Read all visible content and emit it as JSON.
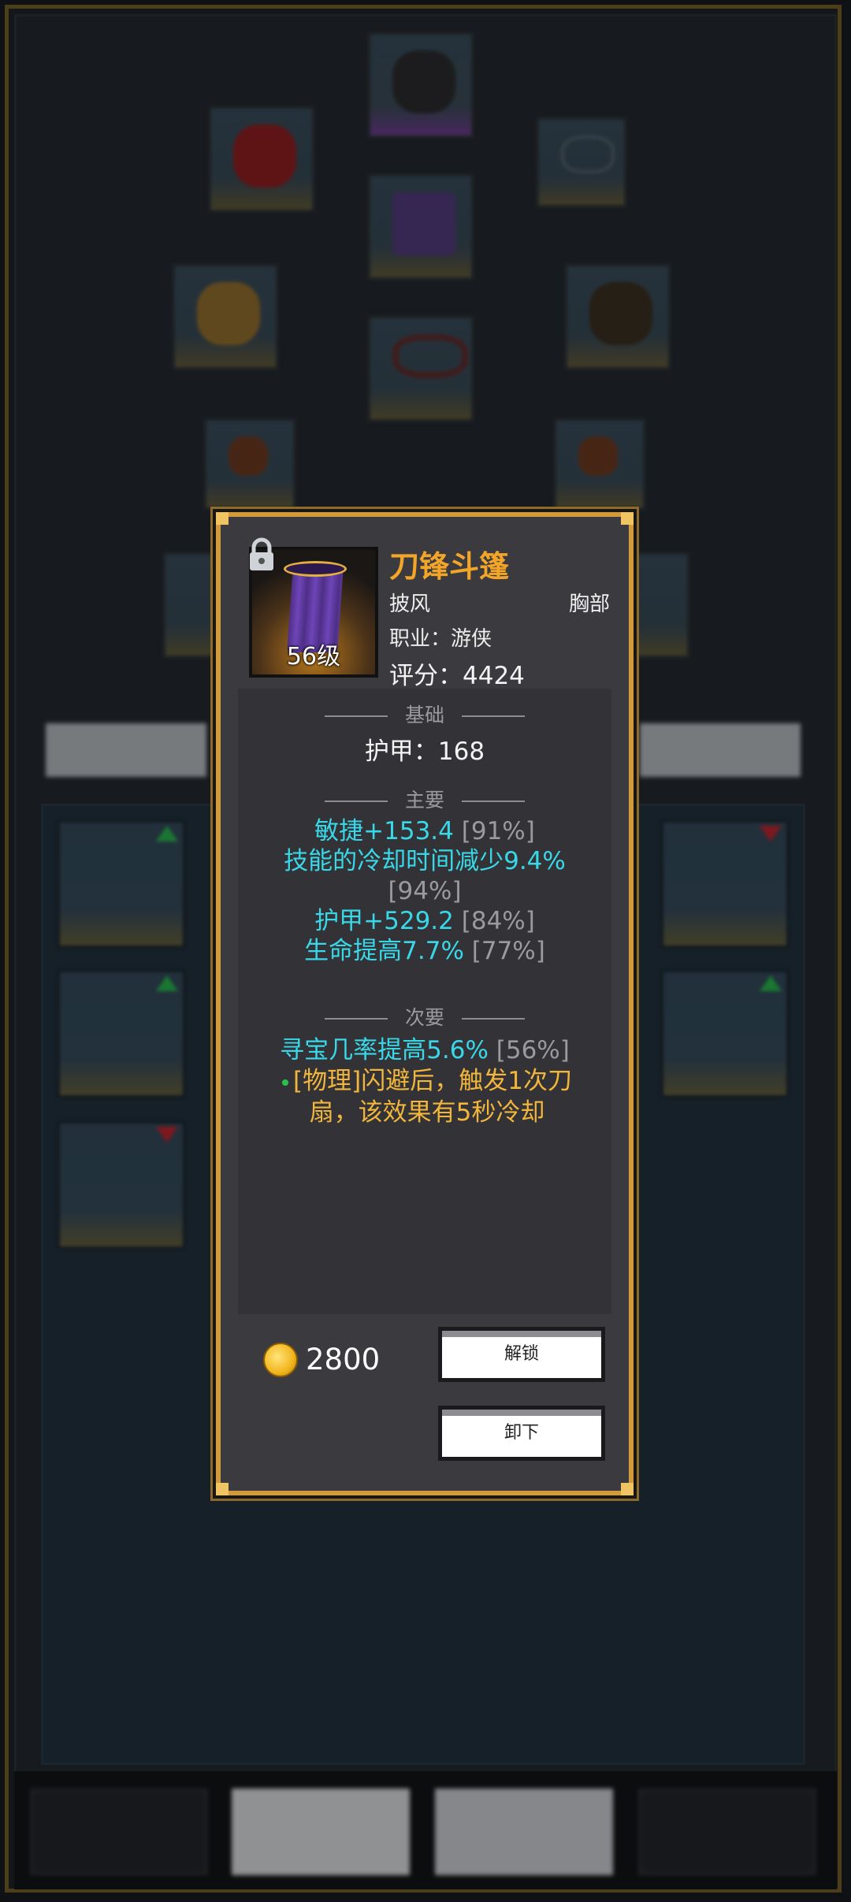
{
  "background": {
    "equipment_slots": [
      {
        "name": "helmet",
        "color": "#2d2d2d"
      },
      {
        "name": "cape-red",
        "color": "#a51a1a"
      },
      {
        "name": "necklace",
        "color": "#3b4d58"
      },
      {
        "name": "cape-purple",
        "color": "#5a3b8a"
      },
      {
        "name": "gloves",
        "color": "#a97a2a"
      },
      {
        "name": "bracer",
        "color": "#3b2d1a"
      },
      {
        "name": "belt",
        "color": "#6a2a2a"
      },
      {
        "name": "ring-left",
        "color": "#7a3a1a"
      },
      {
        "name": "ring-right",
        "color": "#7a3a1a"
      }
    ],
    "inventory_slots": [
      {
        "name": "boots",
        "indicator": "up"
      },
      {
        "name": "armor-red",
        "indicator": "down"
      },
      {
        "name": "spear-left",
        "indicator": "up"
      },
      {
        "name": "spear-right",
        "indicator": "up"
      },
      {
        "name": "necklace-bag",
        "indicator": "down"
      }
    ]
  },
  "tooltip": {
    "item_name": "刀锋斗篷",
    "item_type": "披风",
    "item_slot": "胸部",
    "class_text": "职业：游侠",
    "score_text": "评分：4424",
    "level_text": "56级",
    "sections": {
      "base": {
        "header": "基础",
        "stats": [
          "护甲：168"
        ]
      },
      "primary": {
        "header": "主要",
        "stats": [
          {
            "text": "敏捷+153.4",
            "pct": "[91%]"
          },
          {
            "text": "技能的冷却时间减少9.4%",
            "pct": ""
          },
          {
            "text": "",
            "pct": "[94%]"
          },
          {
            "text": "护甲+529.2",
            "pct": "[84%]"
          },
          {
            "text": "生命提高7.7%",
            "pct": "[77%]"
          }
        ]
      },
      "secondary": {
        "header": "次要",
        "stats": [
          {
            "text": "寻宝几率提高5.6%",
            "pct": "[56%]"
          }
        ],
        "special_line1": "[物理]闪避后，触发1次刀",
        "special_line2": "扇，该效果有5秒冷却"
      }
    },
    "price": "2800",
    "buttons": {
      "unlock": "解锁",
      "unequip": "卸下"
    }
  },
  "colors": {
    "accent_gold": "#d19b3b",
    "name_orange": "#f2a529",
    "stat_cyan": "#39d8e8",
    "special_gold": "#f2b63c"
  }
}
